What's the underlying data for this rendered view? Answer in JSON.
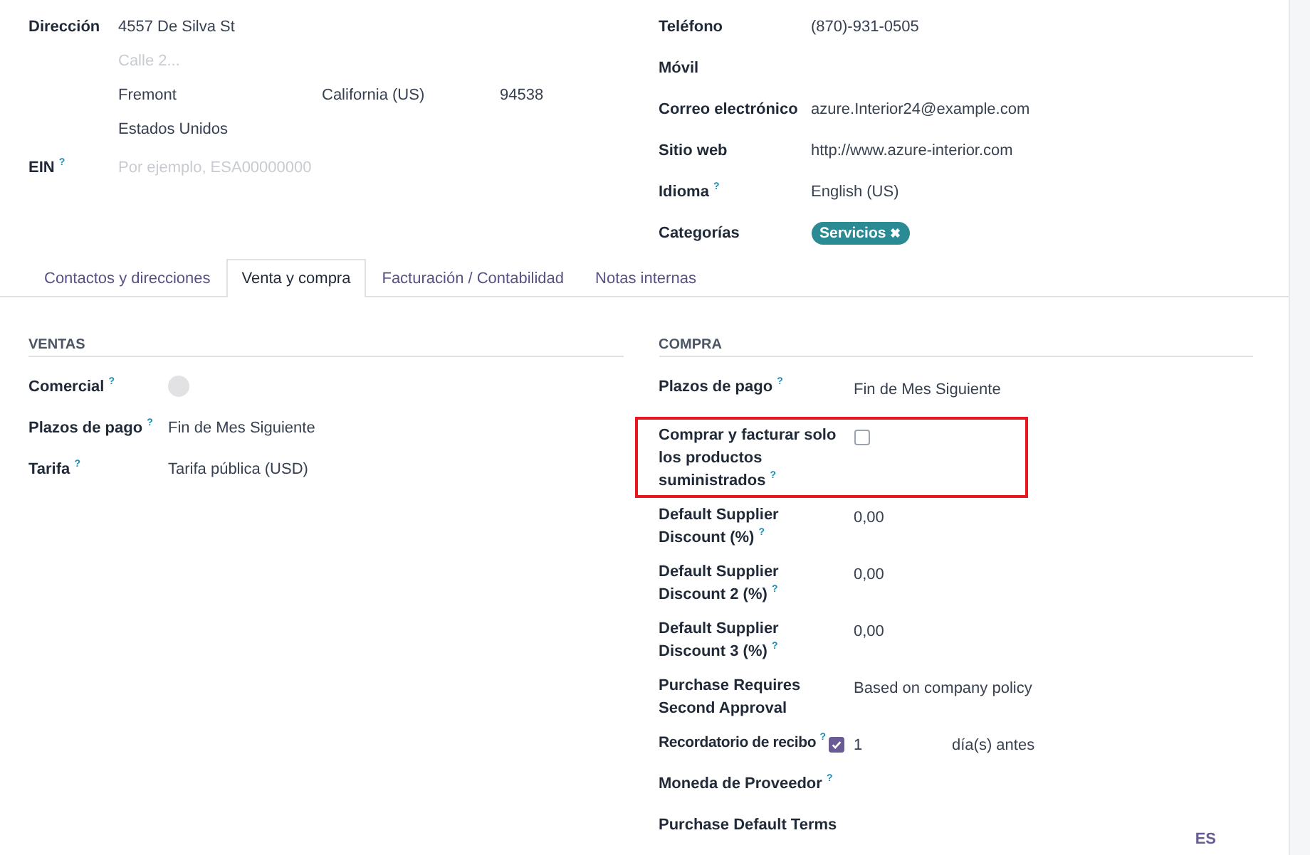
{
  "address": {
    "label": "Dirección",
    "street": "4557 De Silva St",
    "street2": {
      "placeholder": "Calle 2..."
    },
    "city": "Fremont",
    "state": "California (US)",
    "zip": "94538",
    "country": "Estados Unidos"
  },
  "ein": {
    "label": "EIN $^{?}$",
    "placeholder": "Por ejemplo, ESA00000000"
  },
  "contact_fields": [
    {
      "label": "Teléfono",
      "kind": "text",
      "value": "(870)-931-0505"
    },
    {
      "label": "Móvil",
      "kind": "empty"
    },
    {
      "label": "Correo electrónico",
      "kind": "text",
      "value": "azure.Interior24@example.com"
    },
    {
      "label": "Sitio web",
      "kind": "text",
      "value": "http://www.azure-interior.com"
    },
    {
      "label": "Idioma $^{?}$",
      "kind": "text",
      "value": "English (US)"
    },
    {
      "label": "Categorías",
      "kind": "tags",
      "tags": [
        {
          "label": "Servicios",
          "remove": "✖"
        }
      ]
    }
  ],
  "tabs": [
    {
      "label": "Contactos y direcciones",
      "selected": false
    },
    {
      "label": "Venta y compra",
      "selected": true
    },
    {
      "label": "Facturación / Contabilidad",
      "selected": false
    },
    {
      "label": "Notas internas",
      "selected": false
    }
  ],
  "sales": {
    "title": "VENTAS",
    "fields": [
      {
        "label": "Comercial $^{?}$",
        "kind": "avatar"
      },
      {
        "label": "Plazos de pago $^{?}$",
        "kind": "text",
        "value": "Fin de Mes Siguiente"
      },
      {
        "label": "Tarifa $^{?}$",
        "kind": "text",
        "value": "Tarifa pública (USD)"
      }
    ]
  },
  "purchase": {
    "title": "COMPRA",
    "fields": [
      {
        "label": "Plazos de pago $^{?}$",
        "kind": "text",
        "value": "Fin de Mes Siguiente"
      },
      {
        "label": "Comprar y facturar solo los productos suministrados $^{?}$",
        "kind": "checkbox",
        "checked": false,
        "highlighted": true
      },
      {
        "label": "Default Supplier Discount (%) $^{?}$",
        "kind": "text",
        "value": "0,00"
      },
      {
        "label": "Default Supplier Discount 2 (%) $^{?}$",
        "kind": "text",
        "value": "0,00"
      },
      {
        "label": "Default Supplier Discount 3 (%) $^{?}$",
        "kind": "text",
        "value": "0,00"
      },
      {
        "label": "Purchase Requires Second Approval",
        "kind": "text",
        "value": "Based on company policy"
      },
      {
        "label": "Recordatorio de recibo $^{?}$",
        "kind": "reminder",
        "checked": true,
        "value": "1",
        "suffix": "día(s) antes"
      },
      {
        "label": "Moneda de Proveedor $^{?}$",
        "kind": "empty"
      },
      {
        "label": "Purchase Default Terms",
        "kind": "empty"
      }
    ]
  },
  "language_button": "ES"
}
